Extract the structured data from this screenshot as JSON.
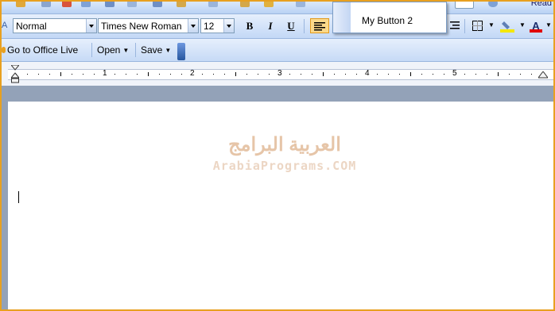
{
  "format_toolbar": {
    "style": "Normal",
    "font": "Times New Roman",
    "size": "12",
    "bold": "B",
    "italic": "I",
    "underline": "U",
    "font_color_letter": "A"
  },
  "live_bar": {
    "go_live": "Go to Office Live",
    "open": "Open",
    "save": "Save"
  },
  "dropdown": {
    "item": "My Button 2"
  },
  "top_toolbar": {
    "cut_text": "Read"
  },
  "ruler": {
    "numbers": [
      "1",
      "2",
      "3",
      "4",
      "5"
    ]
  },
  "watermark": {
    "arabic": "العربية البرامج",
    "latin": "ArabiaPrograms.COM"
  },
  "colors": {
    "accent_border": "#e8a020",
    "toolbar": "#c3d8f6",
    "highlight": "#fbd98a",
    "font_color": "#e00000"
  }
}
